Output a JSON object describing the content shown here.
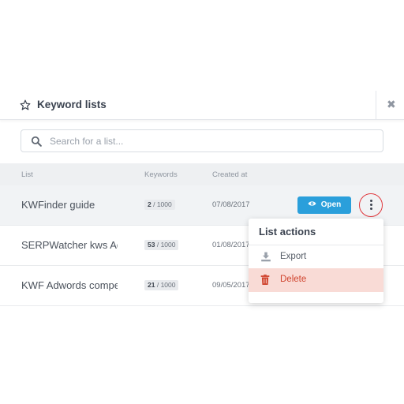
{
  "dialog": {
    "title": "Keyword lists",
    "close_symbol": "✖"
  },
  "search": {
    "placeholder": "Search for a list..."
  },
  "table": {
    "headers": {
      "list": "List",
      "keywords": "Keywords",
      "created": "Created at"
    },
    "rows": [
      {
        "name": "KWFinder guide",
        "kw_count": "2",
        "kw_limit": "/ 1000",
        "created": "07/08/2017"
      },
      {
        "name": "SERPWatcher kws Adwords",
        "kw_count": "53",
        "kw_limit": "/ 1000",
        "created": "01/08/2017"
      },
      {
        "name": "KWF Adwords competitors",
        "kw_count": "21",
        "kw_limit": "/ 1000",
        "created": "09/05/2017"
      }
    ],
    "open_label": "Open"
  },
  "menu": {
    "title": "List actions",
    "export_label": "Export",
    "delete_label": "Delete"
  },
  "colors": {
    "accent": "#2a9fdb",
    "danger": "#d0442e",
    "highlight_ring": "#e0383d"
  },
  "icons": [
    "star-icon",
    "close-icon",
    "search-icon",
    "eye-icon",
    "more-vertical-icon",
    "download-icon",
    "trash-icon"
  ]
}
